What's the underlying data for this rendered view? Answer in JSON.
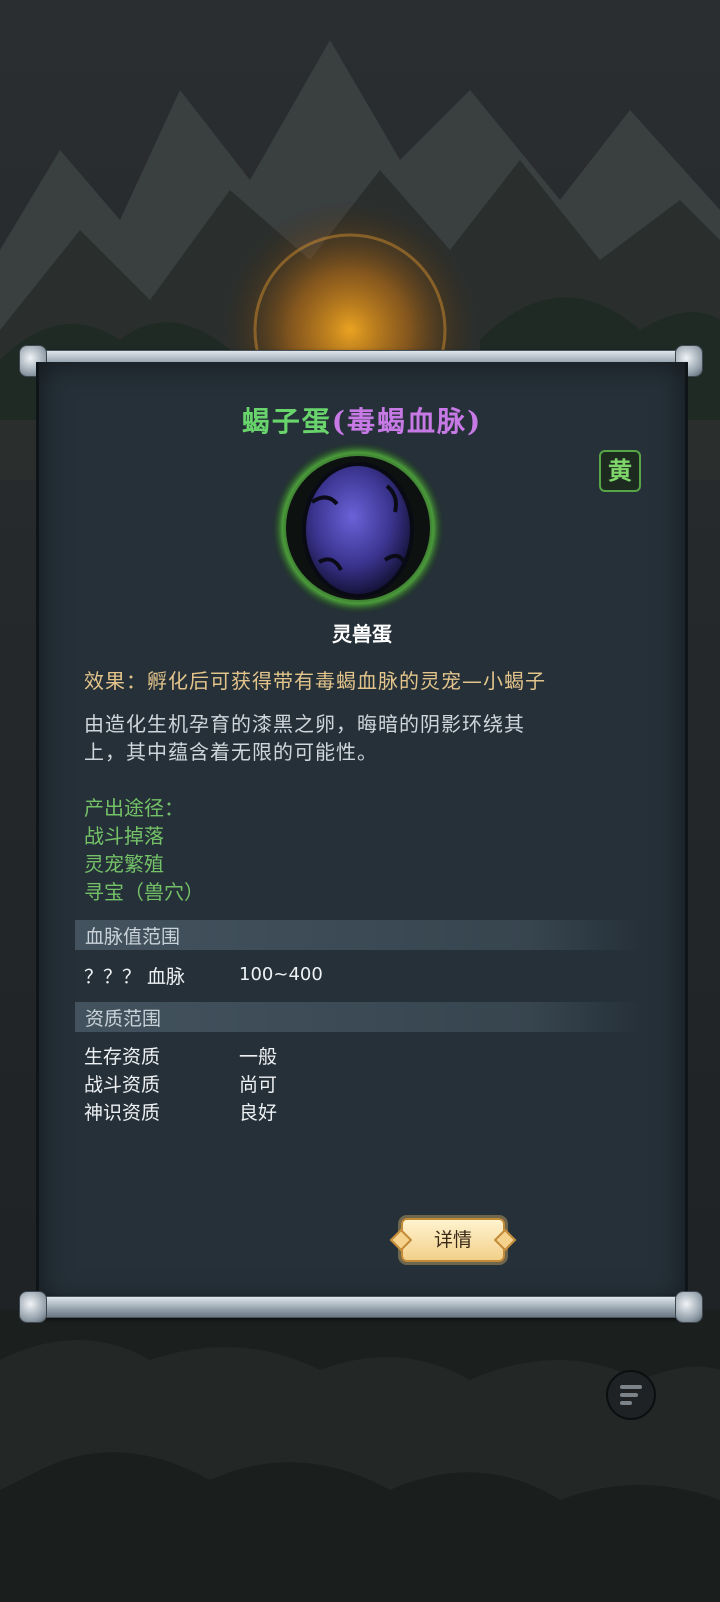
{
  "item": {
    "name": "蝎子蛋",
    "bloodline_suffix": "(毒蝎血脉)",
    "grade_badge": "黄",
    "type": "灵兽蛋",
    "effect": "效果：孵化后可获得带有毒蝎血脉的灵宠—小蝎子",
    "description_line1": "由造化生机孕育的漆黑之卵，晦暗的阴影环绕其",
    "description_line2": "上，其中蕴含着无限的可能性。",
    "sources_header": "产出途径：",
    "sources": [
      "战斗掉落",
      "灵宠繁殖",
      "寻宝（兽穴）"
    ]
  },
  "bloodline_section": {
    "header": "血脉值范围",
    "label": "？？？ 血脉",
    "value": "100~400"
  },
  "aptitude_section": {
    "header": "资质范围",
    "rows": [
      {
        "label": "生存资质",
        "value": "一般"
      },
      {
        "label": "战斗资质",
        "value": "尚可"
      },
      {
        "label": "神识资质",
        "value": "良好"
      }
    ]
  },
  "buttons": {
    "detail": "详情"
  },
  "icons": {
    "menu": "menu-lines-icon",
    "egg": "dark-egg-icon"
  },
  "colors": {
    "name": "#68d46b",
    "bloodline_suffix": "#c77ae6",
    "effect": "#e3c48b",
    "sources": "#74c168",
    "panel": "#253038"
  }
}
